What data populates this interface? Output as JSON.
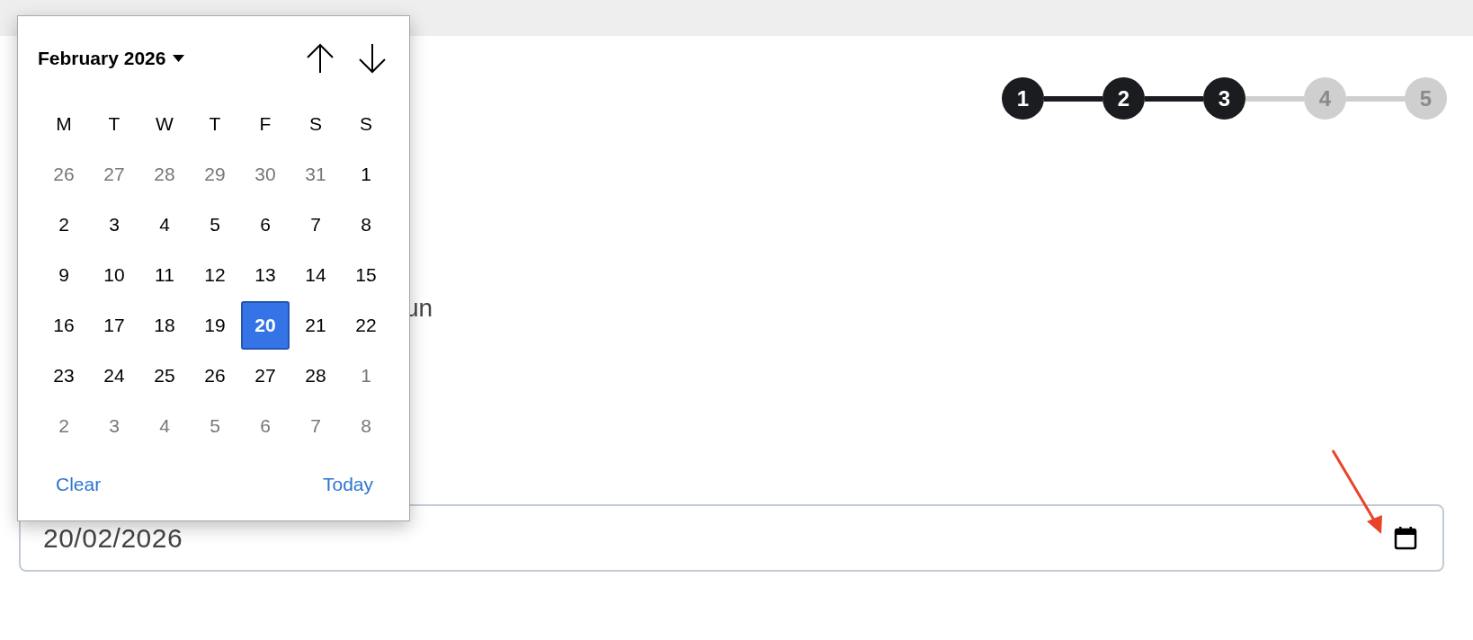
{
  "calendar": {
    "title": "February 2026",
    "weekdays": [
      "M",
      "T",
      "W",
      "T",
      "F",
      "S",
      "S"
    ],
    "weeks": [
      [
        {
          "day": "26",
          "outside": true,
          "selected": false
        },
        {
          "day": "27",
          "outside": true,
          "selected": false
        },
        {
          "day": "28",
          "outside": true,
          "selected": false
        },
        {
          "day": "29",
          "outside": true,
          "selected": false
        },
        {
          "day": "30",
          "outside": true,
          "selected": false
        },
        {
          "day": "31",
          "outside": true,
          "selected": false
        },
        {
          "day": "1",
          "outside": false,
          "selected": false
        }
      ],
      [
        {
          "day": "2",
          "outside": false,
          "selected": false
        },
        {
          "day": "3",
          "outside": false,
          "selected": false
        },
        {
          "day": "4",
          "outside": false,
          "selected": false
        },
        {
          "day": "5",
          "outside": false,
          "selected": false
        },
        {
          "day": "6",
          "outside": false,
          "selected": false
        },
        {
          "day": "7",
          "outside": false,
          "selected": false
        },
        {
          "day": "8",
          "outside": false,
          "selected": false
        }
      ],
      [
        {
          "day": "9",
          "outside": false,
          "selected": false
        },
        {
          "day": "10",
          "outside": false,
          "selected": false
        },
        {
          "day": "11",
          "outside": false,
          "selected": false
        },
        {
          "day": "12",
          "outside": false,
          "selected": false
        },
        {
          "day": "13",
          "outside": false,
          "selected": false
        },
        {
          "day": "14",
          "outside": false,
          "selected": false
        },
        {
          "day": "15",
          "outside": false,
          "selected": false
        }
      ],
      [
        {
          "day": "16",
          "outside": false,
          "selected": false
        },
        {
          "day": "17",
          "outside": false,
          "selected": false
        },
        {
          "day": "18",
          "outside": false,
          "selected": false
        },
        {
          "day": "19",
          "outside": false,
          "selected": false
        },
        {
          "day": "20",
          "outside": false,
          "selected": true
        },
        {
          "day": "21",
          "outside": false,
          "selected": false
        },
        {
          "day": "22",
          "outside": false,
          "selected": false
        }
      ],
      [
        {
          "day": "23",
          "outside": false,
          "selected": false
        },
        {
          "day": "24",
          "outside": false,
          "selected": false
        },
        {
          "day": "25",
          "outside": false,
          "selected": false
        },
        {
          "day": "26",
          "outside": false,
          "selected": false
        },
        {
          "day": "27",
          "outside": false,
          "selected": false
        },
        {
          "day": "28",
          "outside": false,
          "selected": false
        },
        {
          "day": "1",
          "outside": true,
          "selected": false
        }
      ],
      [
        {
          "day": "2",
          "outside": true,
          "selected": false
        },
        {
          "day": "3",
          "outside": true,
          "selected": false
        },
        {
          "day": "4",
          "outside": true,
          "selected": false
        },
        {
          "day": "5",
          "outside": true,
          "selected": false
        },
        {
          "day": "6",
          "outside": true,
          "selected": false
        },
        {
          "day": "7",
          "outside": true,
          "selected": false
        },
        {
          "day": "8",
          "outside": true,
          "selected": false
        }
      ]
    ],
    "actions": [
      "Clear",
      "Today"
    ]
  },
  "stepper": [
    {
      "label": "1",
      "completed": true
    },
    {
      "label": "2",
      "completed": true
    },
    {
      "label": "3",
      "completed": true
    },
    {
      "label": "4",
      "completed": false
    },
    {
      "label": "5",
      "completed": false
    }
  ],
  "body_text": "un",
  "date_field": {
    "value": "20/02/2026"
  }
}
